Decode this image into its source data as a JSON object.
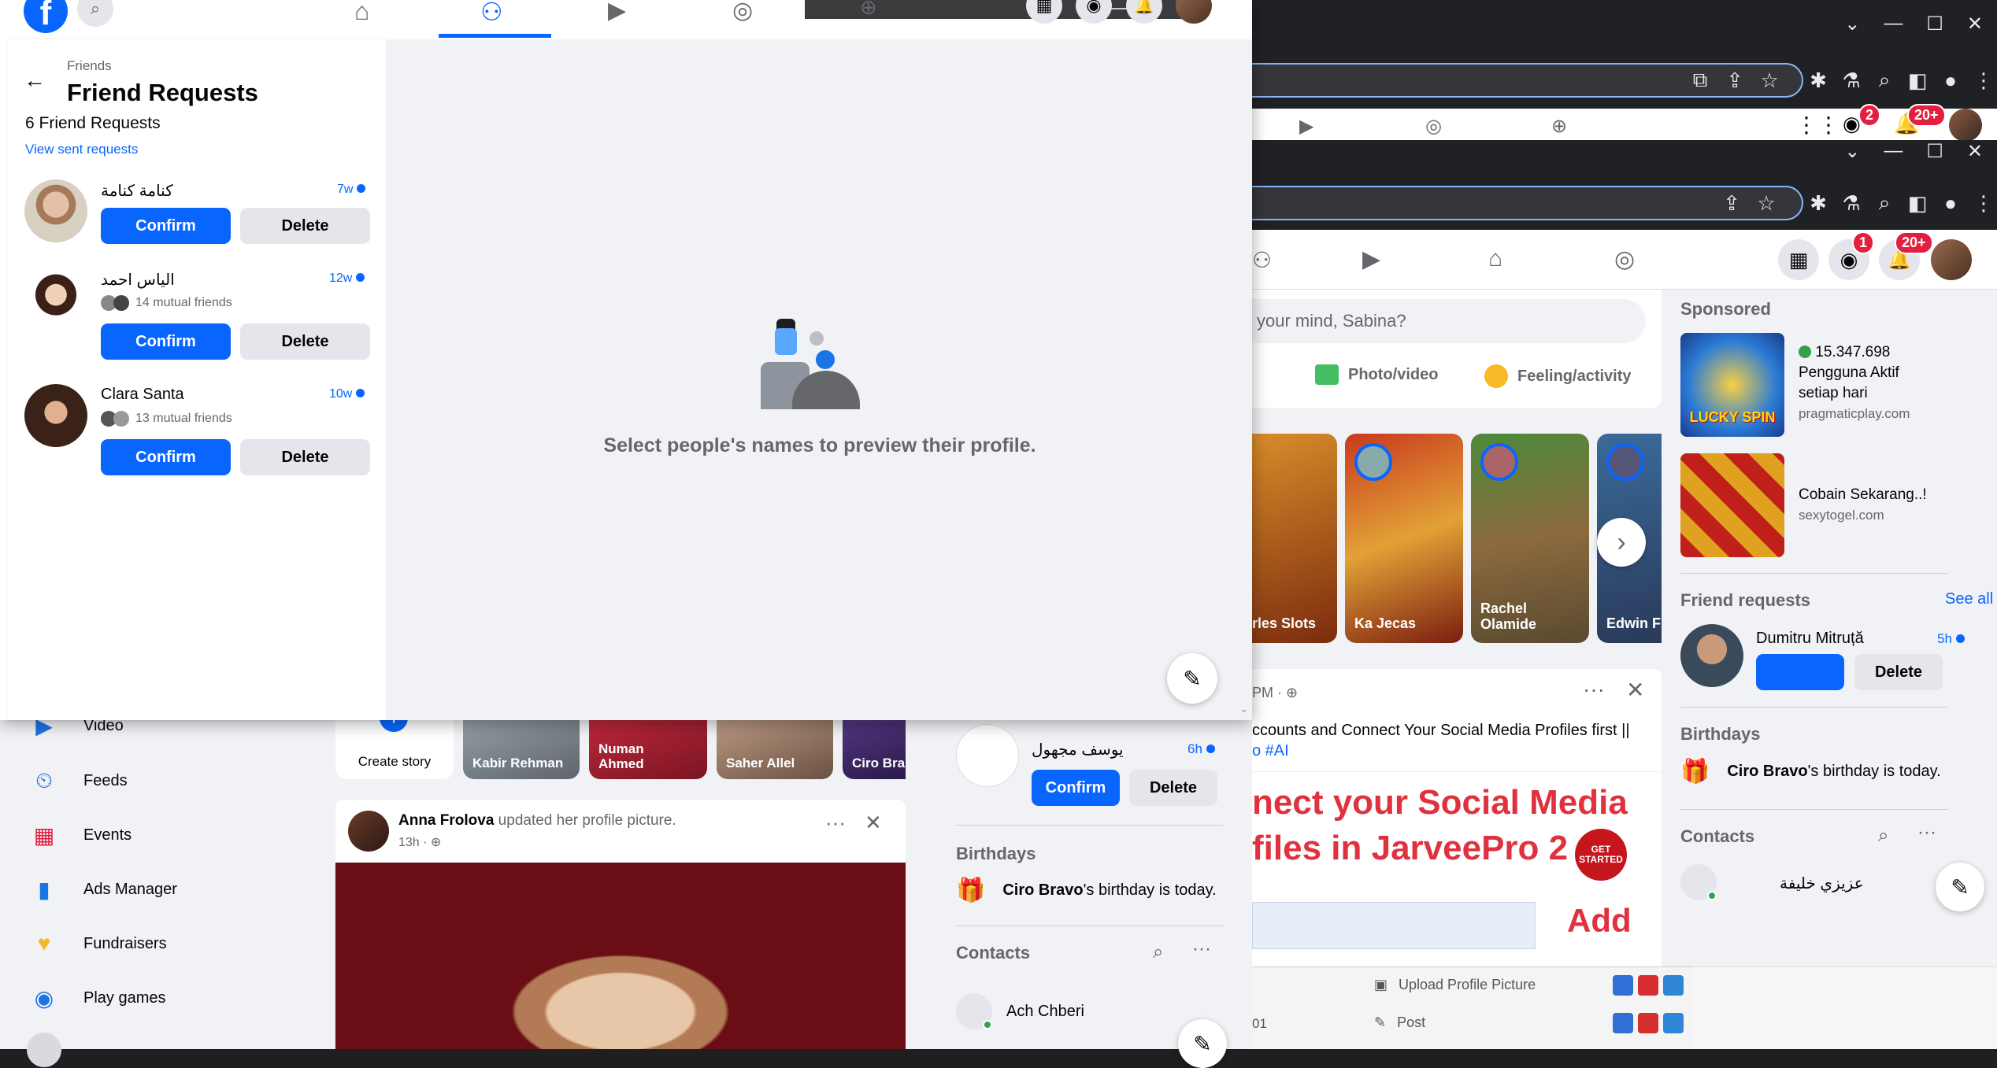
{
  "front": {
    "breadcrumb": "Friends",
    "title": "Friend Requests",
    "count_label": "6 Friend Requests",
    "view_sent": "View sent requests",
    "requests": [
      {
        "name": "كنامة كنامة",
        "time": "7w",
        "mutual": ""
      },
      {
        "name": "الياس احمد",
        "time": "12w",
        "mutual": "14 mutual friends"
      },
      {
        "name": "Clara Santa",
        "time": "10w",
        "mutual": "13 mutual friends"
      }
    ],
    "confirm": "Confirm",
    "delete": "Delete",
    "empty_message": "Select people's names to preview their profile."
  },
  "right": {
    "post_placeholder": "your mind, Sabina?",
    "photo_video": "Photo/video",
    "feeling": "Feeling/activity",
    "messenger_badge_top": "2",
    "notif_badge_top": "20+",
    "messenger_badge": "1",
    "notif_badge": "20+",
    "stories": [
      "rles Slots",
      "Ka Jecas",
      "Rachel Olamide",
      "Edwin Fl"
    ],
    "post_time": "PM ·",
    "post_text_1": "ccounts and Connect Your Social Media Profiles first ||",
    "post_text_2": "o #AI",
    "banner_line1": "nect your Social Media",
    "banner_line2": "files in JarveePro 2",
    "banner_add": "Add",
    "banner_badge": "GET STARTED",
    "bottom_items": [
      "Upload Profile Picture",
      "Post"
    ],
    "bottom_prefix": "01",
    "sponsored": "Sponsored",
    "ad1_line1": "15.347.698",
    "ad1_line2": "Pengguna Aktif",
    "ad1_line3": "setiap hari",
    "ad1_domain": "pragmaticplay.com",
    "ad1_image_text": "LUCKY SPIN",
    "ad2_title": "Cobain Sekarang..!",
    "ad2_domain": "sexytogel.com",
    "friend_requests": "Friend requests",
    "see_all": "See all",
    "req_name": "Dumitru Mitruță",
    "req_time": "5h",
    "birthdays": "Birthdays",
    "birthday_name": "Ciro Bravo",
    "birthday_text": "'s birthday is today.",
    "contacts": "Contacts",
    "contact1": "عزيزي خليفة"
  },
  "back": {
    "menu": [
      "Video",
      "Feeds",
      "Events",
      "Ads Manager",
      "Fundraisers",
      "Play games"
    ],
    "create_story": "Create story",
    "stories": [
      "Kabir Rehman",
      "Numan Ahmed",
      "Saher Allel",
      "Ciro Bra"
    ],
    "post_author": "Anna Frolova",
    "post_action": " updated her profile picture.",
    "post_time": "13h ·",
    "req_name": "يوسف مجهول",
    "req_time": "6h",
    "birthdays": "Birthdays",
    "birthday_name": "Ciro Bravo",
    "birthday_text": "'s birthday is today.",
    "contacts": "Contacts",
    "contact1": "Ach Chberi"
  },
  "colors": {
    "fb_blue": "#0866ff",
    "chrome_dark": "#202124",
    "fb_bg": "#f0f2f5"
  }
}
